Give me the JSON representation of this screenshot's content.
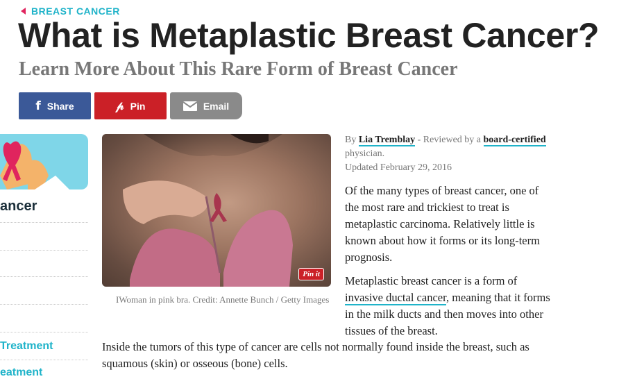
{
  "breadcrumb": {
    "label": "BREAST CANCER"
  },
  "article": {
    "title": "What is Metaplastic Breast Cancer?",
    "subtitle": "Learn More About This Rare Form of Breast Cancer",
    "byline": {
      "prefix": "By",
      "author": "Lia Tremblay",
      "reviewed_text": "- Reviewed by a",
      "reviewed_link": "board-certified",
      "reviewed_suffix": "physician.",
      "updated": "Updated February 29, 2016"
    },
    "paragraph1": "Of the many types of breast cancer, one of the most rare and trickiest to treat is metaplastic carcinoma. Relatively little is known about how it forms or its long-term prognosis.",
    "paragraph2_start": "Metaplastic breast cancer is a form of",
    "paragraph2_link": "invasive ductal cancer",
    "paragraph2_end": ", meaning that it forms in the milk ducts and then moves into other tissues of the breast.",
    "paragraph3": "Inside the tumors of this type of cancer are cells not normally found inside the breast, such as squamous (skin) or osseous (bone) cells."
  },
  "share": {
    "facebook": "Share",
    "pinterest": "Pin",
    "email": "Email"
  },
  "image": {
    "caption": "IWoman in pink bra. Credit: Annette Bunch / Getty Images",
    "pinit_label": "Pin it"
  },
  "sidebar": {
    "heading": "ancer",
    "link1": "Treatment",
    "link2": "eatment"
  },
  "colors": {
    "accent": "#1fb3c9",
    "facebook": "#3b5998",
    "pinterest": "#cb2027",
    "email": "#8a8a8a",
    "ribbon": "#e0245e"
  }
}
